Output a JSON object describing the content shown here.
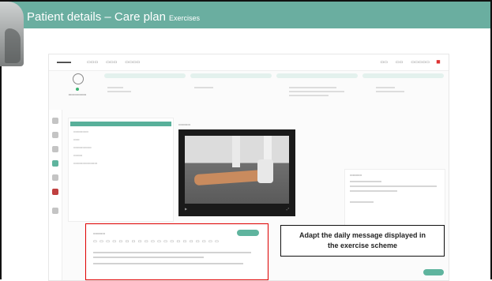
{
  "slide": {
    "title": "Patient details – Care plan",
    "subtitle": "Exercises"
  },
  "callout": {
    "line1": "Adapt the daily message displayed in",
    "line2": "the exercise scheme"
  },
  "colors": {
    "header": "#6aaea0",
    "accent_green": "#5fb49e",
    "highlight_red": "#e00000"
  },
  "icons": [
    "avatar-icon",
    "close-icon",
    "play-icon",
    "fullscreen-icon"
  ]
}
